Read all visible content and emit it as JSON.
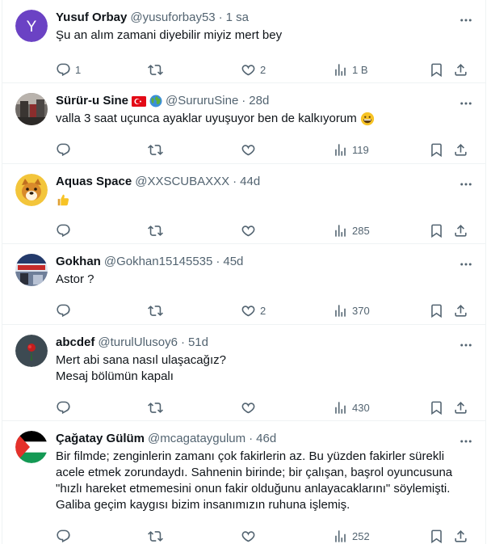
{
  "tweets": [
    {
      "name": "Yusuf Orbay",
      "handle": "@yusuforbay53",
      "time": "1 sa",
      "text": "Şu an alım zamani diyebilir miyiz mert bey",
      "replies": "1",
      "retweets": "",
      "likes": "2",
      "views": "1 B",
      "avatar_letter": "Y",
      "avatar_color": "#6b42c4"
    },
    {
      "name": "Sürür-u Sine",
      "handle": "@SururuSine",
      "time": "28d",
      "text": "valla 3 saat uçunca ayaklar uyuşuyor ben de kalkıyorum",
      "replies": "",
      "retweets": "",
      "likes": "",
      "views": "119"
    },
    {
      "name": "Aquas Space",
      "handle": "@XXSCUBAXXX",
      "time": "44d",
      "text": "",
      "replies": "",
      "retweets": "",
      "likes": "",
      "views": "285"
    },
    {
      "name": "Gokhan",
      "handle": "@Gokhan15145535",
      "time": "45d",
      "text": "Astor ?",
      "replies": "",
      "retweets": "",
      "likes": "2",
      "views": "370"
    },
    {
      "name": "abcdef",
      "handle": "@turulUlusoy6",
      "time": "51d",
      "text": "Mert abi sana nasıl ulaşacağız?\nMesaj bölümün kapalı",
      "replies": "",
      "retweets": "",
      "likes": "",
      "views": "430"
    },
    {
      "name": "Çağatay Gülüm",
      "handle": "@mcagataygulum",
      "time": "46d",
      "text": "Bir filmde; zenginlerin zamanı çok fakirlerin az. Bu yüzden fakirler sürekli acele etmek zorundaydı. Sahnenin birinde; bir çalışan, başrol oyuncusuna \"hızlı hareket etmemesini onun fakir olduğunu anlayacaklarını\" söylemişti. Galiba geçim kaygısı bizim insanımızın ruhuna işlemiş.",
      "replies": "",
      "retweets": "",
      "likes": "",
      "views": "252"
    }
  ],
  "separator": "·",
  "colors": {
    "text": "#0f1419",
    "secondary": "#536471",
    "border": "#eff3f4"
  }
}
